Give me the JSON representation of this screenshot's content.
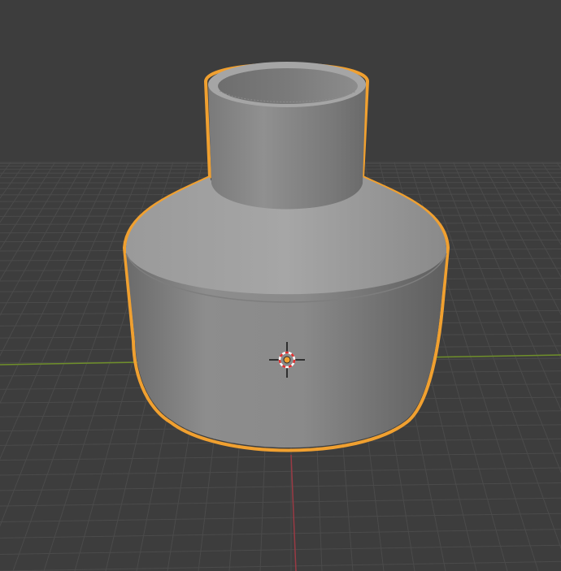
{
  "viewport": {
    "background_color": "#3d3d3d",
    "grid_color": "#4a4a4a",
    "x_axis_color": "#6f8f2a",
    "y_axis_color": "#9a3a44"
  },
  "selected_object": {
    "type": "mesh",
    "shape": "pipe-reducer",
    "outline_color": "#f0a030",
    "surface_color": "#8f8f8f"
  },
  "origin_marker": {
    "icon": "object-origin-icon",
    "color": "#f0a030"
  },
  "cursor_3d": {
    "icon": "3d-cursor-icon",
    "ring_colors": [
      "#ffffff",
      "#e03030"
    ]
  }
}
